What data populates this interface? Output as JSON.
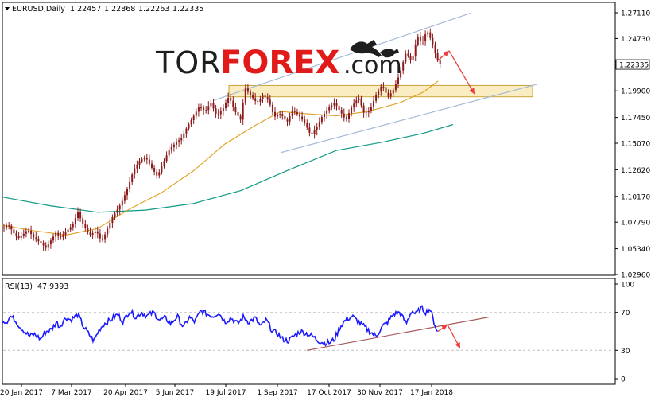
{
  "header": {
    "symbol": "EURUSD,Daily",
    "open": "1.22457",
    "high": "1.22868",
    "low": "1.22263",
    "close": "1.22335",
    "current_price": "1.22335"
  },
  "logo": {
    "part1": "TOR",
    "part2": "FOREX",
    "part3": ".com"
  },
  "rsi_header": {
    "label": "RSI(13)",
    "value": "47.9393"
  },
  "colors": {
    "background": "#ffffff",
    "candle": "#8b1a1a",
    "ma_fast": "#e0a020",
    "ma_slow": "#119986",
    "channel": "#a7b9d8",
    "rsi": "#1a1aff",
    "rsi_trend": "#a85a5a",
    "arrow": "#e84040",
    "zone_fill": "#f6e3a0",
    "zone_stroke": "#c9a43a",
    "grid_dash": "#c0c0c0"
  },
  "chart_data": [
    {
      "type": "candlestick",
      "title": "",
      "ylim": [
        1.0296,
        1.2711
      ],
      "y_ticks": [
        "1.27110",
        "1.24730",
        "1.22335",
        "1.19900",
        "1.17450",
        "1.15070",
        "1.12620",
        "1.10170",
        "1.07790",
        "1.05340",
        "1.02960"
      ],
      "x_ticks": [
        "20 Jan 2017",
        "7 Mar 2017",
        "20 Apr 2017",
        "5 Jun 2017",
        "19 Jul 2017",
        "1 Sep 2017",
        "17 Oct 2017",
        "30 Nov 2017",
        "17 Jan 2018"
      ],
      "close_series": {
        "x": [
          0,
          7,
          14,
          20,
          25,
          32,
          40,
          48,
          55,
          60,
          68,
          72,
          80,
          88,
          95,
          100,
          110,
          118,
          125,
          130,
          138,
          145,
          150,
          158,
          165,
          172,
          180,
          188,
          195,
          202,
          210,
          218,
          225,
          232,
          240,
          248,
          255,
          262,
          270,
          278,
          285,
          292,
          300,
          305,
          312,
          320,
          328,
          335,
          342,
          350,
          358,
          365,
          372,
          380,
          388,
          395,
          402,
          410,
          418,
          425,
          432,
          440,
          448,
          455,
          462,
          470,
          478,
          485,
          492,
          500,
          508,
          515,
          522,
          528,
          534,
          540,
          546,
          551
        ],
        "y": [
          1.072,
          1.076,
          1.068,
          1.063,
          1.066,
          1.071,
          1.063,
          1.059,
          1.054,
          1.06,
          1.069,
          1.063,
          1.069,
          1.075,
          1.087,
          1.078,
          1.066,
          1.07,
          1.06,
          1.068,
          1.082,
          1.09,
          1.096,
          1.11,
          1.126,
          1.134,
          1.138,
          1.128,
          1.12,
          1.132,
          1.145,
          1.151,
          1.155,
          1.165,
          1.175,
          1.185,
          1.18,
          1.188,
          1.176,
          1.183,
          1.194,
          1.181,
          1.172,
          1.202,
          1.195,
          1.188,
          1.195,
          1.19,
          1.175,
          1.178,
          1.17,
          1.181,
          1.177,
          1.17,
          1.158,
          1.165,
          1.175,
          1.183,
          1.188,
          1.18,
          1.172,
          1.185,
          1.193,
          1.178,
          1.181,
          1.195,
          1.205,
          1.193,
          1.2,
          1.215,
          1.235,
          1.225,
          1.25,
          1.243,
          1.255,
          1.245,
          1.23,
          1.223
        ]
      },
      "ma_fast": {
        "x": [
          0,
          40,
          80,
          120,
          160,
          200,
          240,
          280,
          320,
          350,
          380,
          420,
          460,
          500,
          530,
          548
        ],
        "y": [
          1.075,
          1.07,
          1.066,
          1.072,
          1.09,
          1.105,
          1.125,
          1.15,
          1.168,
          1.18,
          1.178,
          1.176,
          1.18,
          1.188,
          1.198,
          1.208
        ]
      },
      "ma_slow": {
        "x": [
          0,
          60,
          120,
          180,
          240,
          300,
          360,
          420,
          480,
          530,
          567
        ],
        "y": [
          1.101,
          1.093,
          1.087,
          1.089,
          1.095,
          1.107,
          1.126,
          1.144,
          1.152,
          1.16,
          1.168
        ]
      },
      "channel": {
        "upper": {
          "x": [
            265,
            590
          ],
          "y": [
            1.19,
            1.271
          ]
        },
        "lower": {
          "x": [
            350,
            672
          ],
          "y": [
            1.142,
            1.205
          ]
        }
      },
      "zone": {
        "x0": 285,
        "x1": 667,
        "y0": 1.1935,
        "y1": 1.204
      },
      "annotations": [
        {
          "kind": "arrow",
          "from": {
            "x": 548,
            "y": 1.227
          },
          "to": {
            "x": 562,
            "y": 1.236
          }
        },
        {
          "kind": "arrow",
          "from": {
            "x": 562,
            "y": 1.236
          },
          "to": {
            "x": 594,
            "y": 1.196
          }
        }
      ]
    },
    {
      "type": "line",
      "title": "",
      "ylim": [
        0,
        100
      ],
      "y_ticks": [
        "100",
        "70",
        "30",
        "0"
      ],
      "series": [
        {
          "x": [
            0,
            5,
            10,
            16,
            22,
            28,
            34,
            40,
            48,
            55,
            62,
            68,
            72,
            80,
            86,
            95,
            102,
            108,
            115,
            122,
            128,
            136,
            145,
            152,
            160,
            168,
            175,
            182,
            190,
            198,
            205,
            212,
            220,
            228,
            235,
            242,
            250,
            258,
            265,
            272,
            280,
            288,
            296,
            303,
            310,
            318,
            325,
            332,
            340,
            346,
            352,
            360,
            368,
            375,
            382,
            390,
            398,
            405,
            412,
            418,
            425,
            432,
            440,
            448,
            455,
            462,
            470,
            478,
            485,
            492,
            500,
            508,
            515,
            520,
            527,
            533,
            538,
            543,
            548
          ],
          "y": [
            62,
            60,
            66,
            62,
            55,
            50,
            45,
            47,
            42,
            50,
            52,
            60,
            55,
            65,
            62,
            68,
            55,
            48,
            40,
            52,
            58,
            62,
            68,
            60,
            72,
            65,
            70,
            66,
            70,
            62,
            64,
            58,
            66,
            54,
            65,
            60,
            72,
            68,
            66,
            70,
            60,
            64,
            58,
            65,
            60,
            64,
            55,
            62,
            50,
            48,
            42,
            40,
            46,
            50,
            48,
            45,
            40,
            38,
            38,
            42,
            55,
            62,
            66,
            60,
            55,
            50,
            45,
            55,
            60,
            68,
            70,
            58,
            72,
            68,
            75,
            70,
            74,
            60,
            48
          ]
        }
      ],
      "trendline": {
        "x": [
          383,
          612
        ],
        "y": [
          30,
          65
        ]
      },
      "annotations": [
        {
          "kind": "arrow",
          "from": {
            "x": 548,
            "y": 50
          },
          "to": {
            "x": 560,
            "y": 57
          }
        },
        {
          "kind": "arrow",
          "from": {
            "x": 560,
            "y": 57
          },
          "to": {
            "x": 576,
            "y": 32
          }
        }
      ]
    }
  ]
}
